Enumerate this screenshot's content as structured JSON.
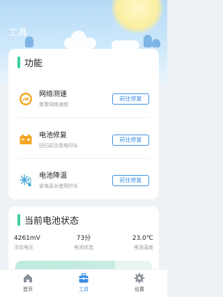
{
  "header": {
    "title": "工具"
  },
  "functions": {
    "title": "功能",
    "items": [
      {
        "name": "网络测速",
        "desc": "查看网络速度",
        "button": "前往修复",
        "icon": "speedometer-icon"
      },
      {
        "name": "电池修复",
        "desc": "回归初次用电时长",
        "button": "前往修复",
        "icon": "battery-icon"
      },
      {
        "name": "电池降温",
        "desc": "省电延长使用时长",
        "button": "前往修复",
        "icon": "snowflake-thermometer-icon"
      }
    ]
  },
  "battery": {
    "title": "当前电池状态",
    "stats": [
      {
        "value": "4261mV",
        "label": "当前电压"
      },
      {
        "value": "73分",
        "label": "电池状态"
      },
      {
        "value": "23.0℃",
        "label": "电池温度"
      }
    ],
    "level_fraction": 0.73
  },
  "tabs": [
    {
      "label": "首页",
      "icon": "home-icon",
      "active": false
    },
    {
      "label": "工具",
      "icon": "toolbox-icon",
      "active": true
    },
    {
      "label": "设置",
      "icon": "gear-icon",
      "active": false
    }
  ],
  "colors": {
    "accent": "#3e8fe3",
    "section_bar": "#3fcf9f",
    "orange": "#f5a623"
  }
}
